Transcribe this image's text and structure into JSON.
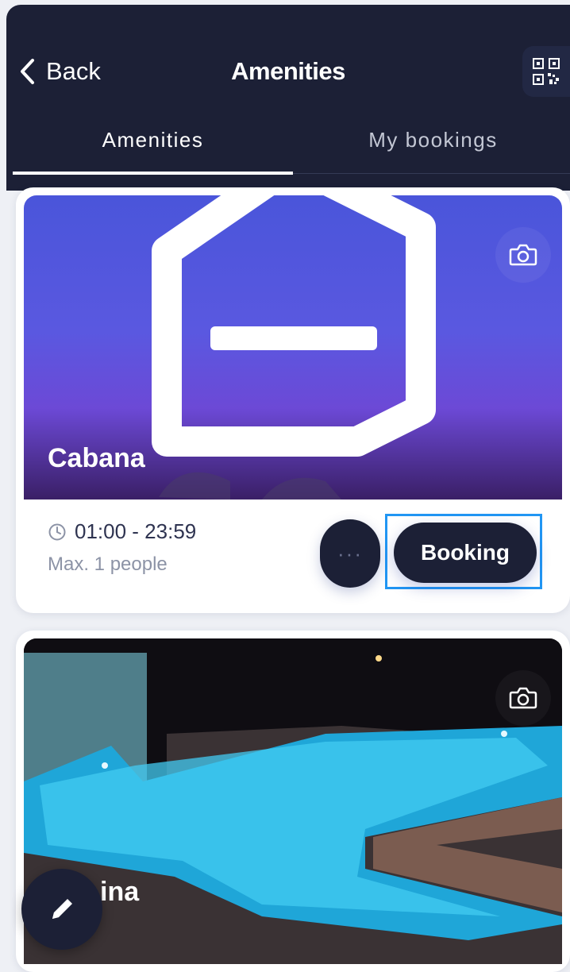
{
  "header": {
    "back_label": "Back",
    "title": "Amenities",
    "qr_icon": "qr-code-icon"
  },
  "tabs": [
    {
      "label": "Amenities",
      "active": true
    },
    {
      "label": "My bookings",
      "active": false
    }
  ],
  "amenities": [
    {
      "name": "Cabana",
      "hours": "01:00 - 23:59",
      "max_people": "Max. 1 people",
      "more_label": "···",
      "book_label": "Booking",
      "camera_icon": "camera-icon"
    },
    {
      "name": "ina",
      "camera_icon": "camera-icon"
    }
  ],
  "fab_icon": "pencil-icon",
  "colors": {
    "primary_dark": "#1c2036",
    "focus_outline": "#2196f3",
    "muted_text": "#8c93a6",
    "background": "#eef0f5"
  }
}
